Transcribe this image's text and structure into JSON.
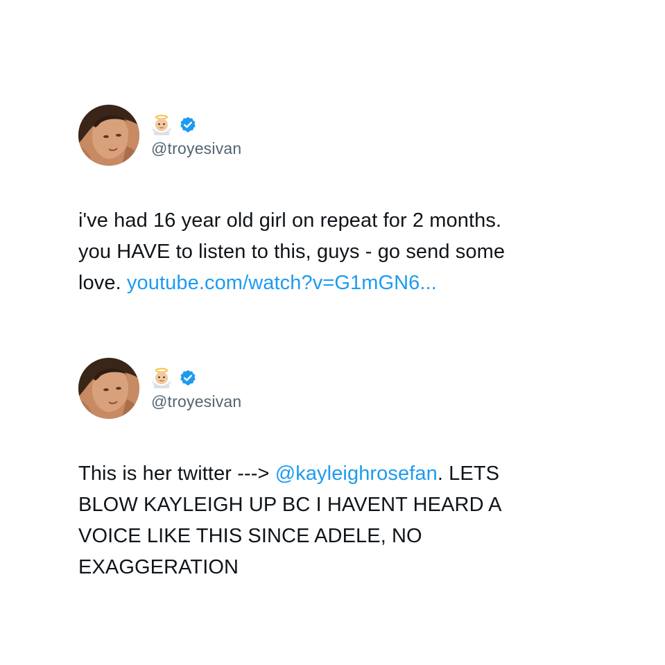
{
  "tweets": [
    {
      "avatar_icon": "profile-photo",
      "name_emoji_icon": "baby-angel-emoji-icon",
      "verified_icon": "verified-badge-icon",
      "handle": "@troyesivan",
      "text_lines": [
        {
          "segments": [
            {
              "text": "i've had 16 year old girl on repeat for 2 months.",
              "kind": "text"
            }
          ]
        },
        {
          "segments": [
            {
              "text": "you HAVE to listen to this, guys - go send some",
              "kind": "text"
            }
          ]
        },
        {
          "segments": [
            {
              "text": "love. ",
              "kind": "text"
            },
            {
              "text": "youtube.com/watch?v=G1mGN6...",
              "kind": "link"
            }
          ]
        }
      ]
    },
    {
      "avatar_icon": "profile-photo",
      "name_emoji_icon": "baby-angel-emoji-icon",
      "verified_icon": "verified-badge-icon",
      "handle": "@troyesivan",
      "text_lines": [
        {
          "segments": [
            {
              "text": "This is her twitter ---> ",
              "kind": "text"
            },
            {
              "text": "@kayleighrosefan",
              "kind": "link"
            },
            {
              "text": ". LETS",
              "kind": "text"
            }
          ]
        },
        {
          "segments": [
            {
              "text": "BLOW KAYLEIGH UP BC I HAVENT HEARD A",
              "kind": "text"
            }
          ]
        },
        {
          "segments": [
            {
              "text": "VOICE LIKE THIS SINCE ADELE, NO",
              "kind": "text"
            }
          ]
        },
        {
          "segments": [
            {
              "text": "EXAGGERATION",
              "kind": "text"
            }
          ]
        }
      ]
    }
  ],
  "colors": {
    "link": "#1d9bf0",
    "handle": "#536471",
    "text": "#0f1419",
    "verified": "#1d9bf0",
    "background": "#ffffff"
  }
}
